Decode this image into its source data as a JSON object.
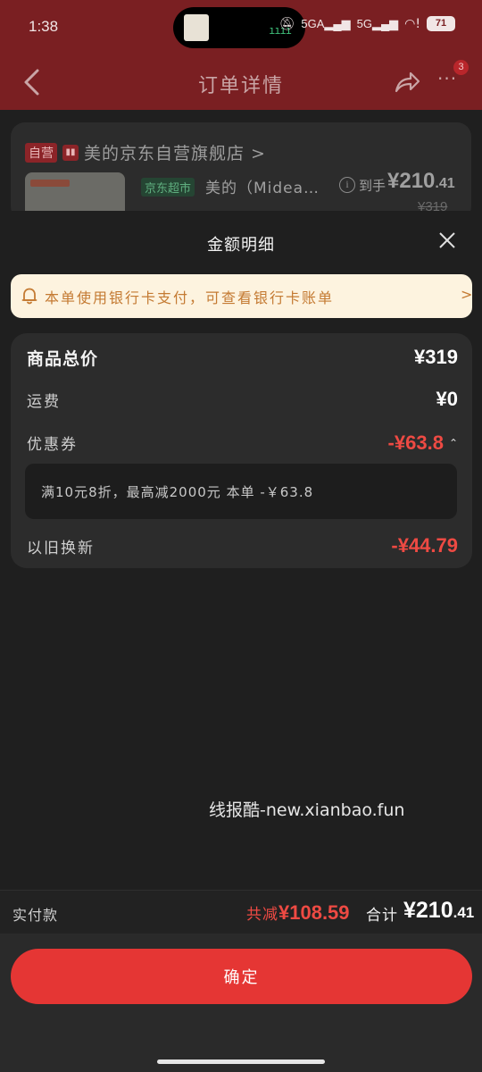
{
  "status_bar": {
    "time": "1:38",
    "signal1": "5GA",
    "signal2": "5G",
    "battery": "71"
  },
  "nav": {
    "title": "订单详情",
    "more_badge": "3"
  },
  "order": {
    "self_tag": "自营",
    "store_name": "美的京东自营旗舰店 >",
    "jd_tag": "京东超市",
    "product_title": "美的（Midea…",
    "got_label": "到手",
    "got_price_int": "¥210",
    "got_price_dec": ".41",
    "orig_price": "¥319"
  },
  "sheet": {
    "title": "金额明细",
    "notice": "本单使用银行卡支付，可查看银行卡账单",
    "notice_arrow": ">",
    "rows": {
      "goods_label": "商品总价",
      "goods_value": "¥319",
      "shipping_label": "运费",
      "shipping_value": "¥0",
      "coupon_label": "优惠券",
      "coupon_value": "-¥63.8",
      "coupon_detail": "满10元8折，最高减2000元   本单 -￥63.8",
      "tradein_label": "以旧换新",
      "tradein_value": "-¥44.79"
    },
    "watermark": "线报酷-new.xianbao.fun"
  },
  "footer": {
    "pay_label": "实付款",
    "total_off_label": "共减",
    "total_off_value": "¥108.59",
    "total_label": "合计",
    "total_int": "¥210",
    "total_dec": ".41",
    "confirm_label": "确定"
  },
  "colors": {
    "accent_red": "#e53634",
    "discount_red": "#ee4a43",
    "notice_bg": "#fdf3df",
    "notice_text": "#c47a32"
  }
}
